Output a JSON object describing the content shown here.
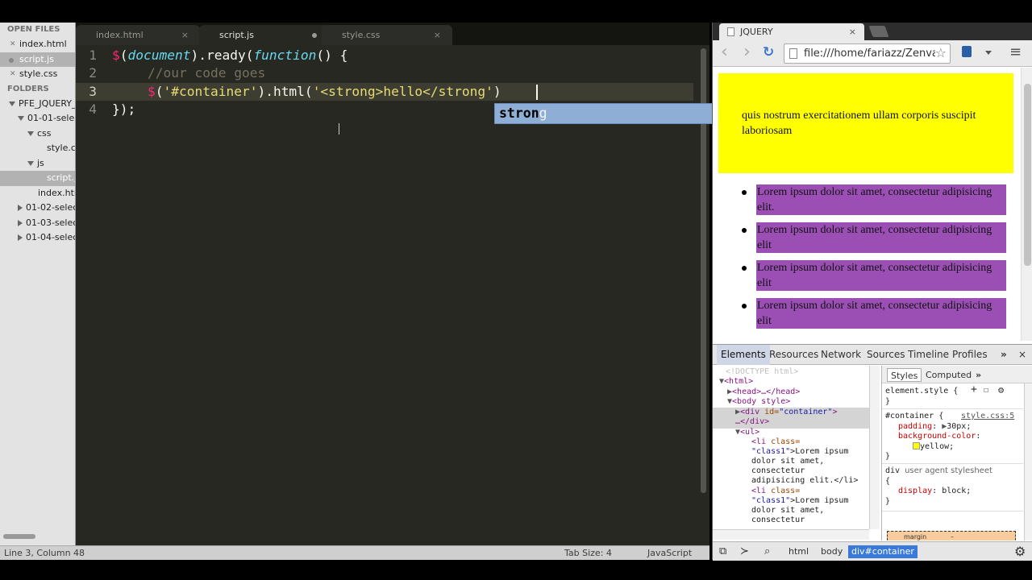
{
  "editor": {
    "sidebar": {
      "open_files_header": "OPEN FILES",
      "open_files": [
        {
          "name": "index.html"
        },
        {
          "name": "script.js"
        },
        {
          "name": "style.css"
        }
      ],
      "folders_header": "FOLDERS",
      "tree": [
        {
          "label": "PFE_JQUERY_"
        },
        {
          "label": "01-01-selec"
        },
        {
          "label": "css"
        },
        {
          "label": "style.c"
        },
        {
          "label": "js"
        },
        {
          "label": "script.j"
        },
        {
          "label": "index.htm"
        },
        {
          "label": "01-02-selec"
        },
        {
          "label": "01-03-selec"
        },
        {
          "label": "01-04-selec"
        }
      ]
    },
    "tabs": [
      {
        "label": "index.html"
      },
      {
        "label": "script.js"
      },
      {
        "label": "style.css"
      }
    ],
    "tab_close_glyph": "×",
    "line_numbers": [
      "1",
      "2",
      "3",
      "4"
    ],
    "code": {
      "l1": {
        "a": "$",
        "b": "(",
        "c": "document",
        "d": ").ready(",
        "e": "function",
        "f": "() {"
      },
      "l2": {
        "comment": "//our code goes"
      },
      "l3": {
        "a": "$",
        "b": "(",
        "c": "'#container'",
        "d": ").html(",
        "e": "'<strong>hello</strong",
        "f": "'",
        "g": ")"
      },
      "l4": {
        "text": "});"
      }
    },
    "autocomplete": {
      "match": "stron",
      "rest": "g"
    },
    "status": {
      "position": "Line 3, Column 48",
      "tab_size": "Tab Size: 4",
      "syntax": "JavaScript"
    }
  },
  "browser": {
    "tab_title": "JQUERY",
    "tab_close": "×",
    "url": "file:///home/fariazz/Zenva",
    "nav": {
      "back": "‹",
      "forward": "›",
      "reload": "↻",
      "star": "☆",
      "menu": "≡"
    },
    "page": {
      "container_text": "quis nostrum exercitationem ullam corporis suscipit laboriosam",
      "list_items": [
        "Lorem ipsum dolor sit amet, consectetur adipisicing elit.",
        "Lorem ipsum dolor sit amet, consectetur adipisicing elit",
        "Lorem ipsum dolor sit amet, consectetur adipisicing elit",
        "Lorem ipsum dolor sit amet, consectetur adipisicing elit"
      ],
      "colors": {
        "container_bg": "#ffff00",
        "li_bg": "#9b4fb5"
      }
    },
    "devtools": {
      "tabs": [
        "Elements",
        "Resources",
        "Network",
        "Sources",
        "Timeline",
        "Profiles"
      ],
      "more": "»",
      "close": "×",
      "dom": {
        "doctype": "<!DOCTYPE html>",
        "html_open": "<html>",
        "head": "<head>…</head>",
        "body_open": "<body style>",
        "div_tag": "<div ",
        "div_attr": "id=",
        "div_val": "\"container\"",
        "div_end": ">",
        "div_close": "…</div>",
        "ul_open": "<ul>",
        "li_tag": "<li ",
        "li_attr": "class=",
        "li_val": "\"class1\"",
        "li1_text": ">Lorem ipsum",
        "li1_text2": "dolor sit amet,",
        "li1_text3": "consectetur",
        "li1_text4": "adipisicing elit.</li>",
        "li2_text": ">Lorem ipsum",
        "li2_text2": "dolor sit amet,",
        "li2_text3": "consectetur"
      },
      "styles": {
        "tabs": [
          "Styles",
          "Computed"
        ],
        "more": "»",
        "element_style": "element.style {",
        "close_brace": "}",
        "rule1_selector": "#container {",
        "rule1_source": "style.css:5",
        "rule1_prop1": "padding",
        "rule1_val1": "30px;",
        "rule1_prop2": "background-color",
        "rule1_val2": "yellow;",
        "rule2_selector": "div",
        "rule2_source": "user agent stylesheet",
        "rule2_open": "{",
        "rule2_prop": "display",
        "rule2_val": "block;",
        "box_label": "margin",
        "box_value": "–"
      },
      "breadcrumbs": [
        "html",
        "body",
        "div#container"
      ]
    }
  }
}
